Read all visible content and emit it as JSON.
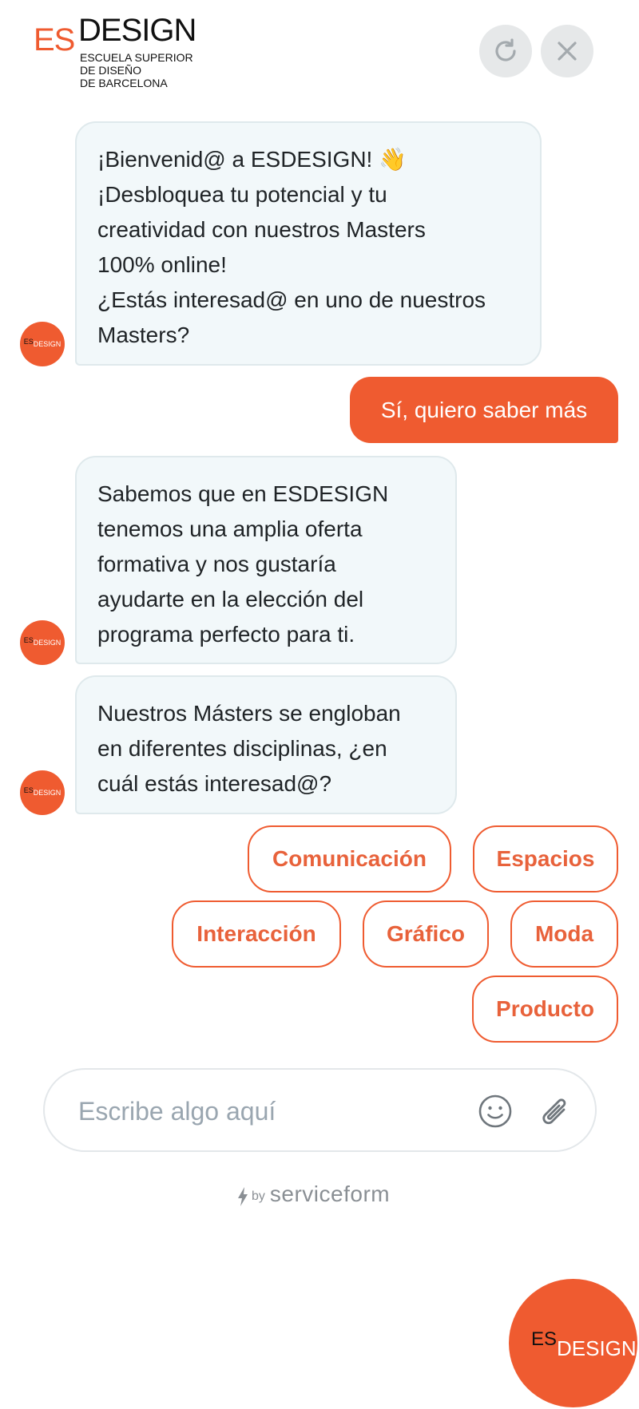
{
  "header": {
    "logo": {
      "es": "ES",
      "design": "DESIGN",
      "subtitle_lines": [
        "ESCUELA SUPERIOR",
        "DE DISEÑO",
        "DE BARCELONA"
      ]
    },
    "refresh_icon": "refresh-icon",
    "close_icon": "close-icon"
  },
  "messages": [
    {
      "from": "bot",
      "lines": [
        "¡Bienvenid@ a ESDESIGN! 👋",
        "¡Desbloquea tu potencial y tu",
        "creatividad con nuestros Masters",
        "100% online!",
        "¿Estás interesad@ en uno de nuestros",
        "Masters?"
      ]
    },
    {
      "from": "user",
      "text": "Sí, quiero saber más"
    },
    {
      "from": "bot",
      "lines": [
        "Sabemos que en ESDESIGN",
        "tenemos una amplia oferta",
        "formativa y nos gustaría",
        "ayudarte en la elección del",
        "programa perfecto para ti."
      ]
    },
    {
      "from": "bot",
      "lines": [
        "Nuestros Másters se engloban",
        "en diferentes disciplinas, ¿en",
        "cuál estás interesad@?"
      ]
    }
  ],
  "avatar": {
    "es": "ES",
    "design": "DESIGN"
  },
  "options": [
    "Comunicación",
    "Espacios",
    "Interacción",
    "Gráfico",
    "Moda",
    "Producto"
  ],
  "composer": {
    "placeholder": "Escribe algo aquí",
    "emoji_icon": "smiley-icon",
    "attach_icon": "paperclip-icon"
  },
  "footer": {
    "by": "by",
    "brand": "serviceform"
  },
  "launcher": {
    "es": "ES",
    "design": "DESIGN"
  },
  "colors": {
    "accent": "#ef5b30",
    "bubble_bg": "#f2f8fa",
    "muted": "#9aa6b0"
  }
}
